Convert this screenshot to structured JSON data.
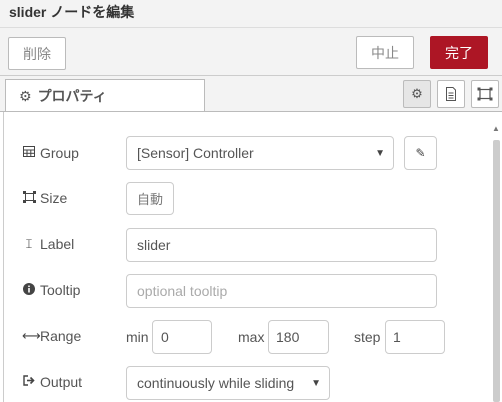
{
  "dialog": {
    "title": "slider ノードを編集",
    "delete_label": "削除",
    "cancel_label": "中止",
    "done_label": "完了"
  },
  "tabs": {
    "properties_label": "プロパティ"
  },
  "form": {
    "group": {
      "label": "Group",
      "value": "[Sensor] Controller"
    },
    "size": {
      "label": "Size",
      "value": "自動"
    },
    "label": {
      "label": "Label",
      "value": "slider"
    },
    "tooltip": {
      "label": "Tooltip",
      "placeholder": "optional tooltip"
    },
    "range": {
      "label": "Range",
      "min_label": "min",
      "min_value": "0",
      "max_label": "max",
      "max_value": "180",
      "step_label": "step",
      "step_value": "1"
    },
    "output": {
      "label": "Output",
      "value": "continuously while sliding"
    }
  }
}
